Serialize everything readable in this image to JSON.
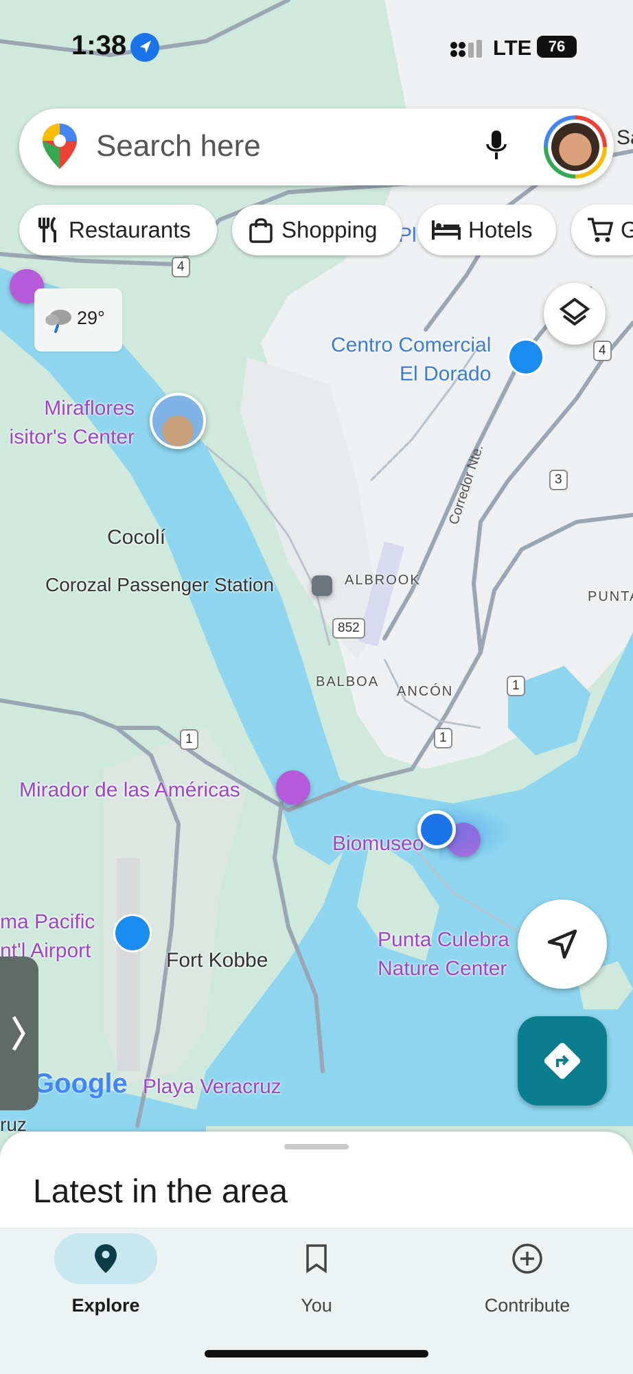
{
  "status_bar": {
    "time": "1:38",
    "network": "LTE",
    "battery": "76"
  },
  "search": {
    "placeholder": "Search here",
    "partial_label": "Sa"
  },
  "chips": [
    {
      "label": "Restaurants",
      "icon": "utensils-icon"
    },
    {
      "label": "Shopping",
      "icon": "shopping-bag-icon"
    },
    {
      "label": "Hotels",
      "icon": "bed-icon"
    },
    {
      "label": "G",
      "icon": "cart-icon"
    }
  ],
  "weather": {
    "temperature": "29°",
    "icon": "rain-cloud-icon"
  },
  "map": {
    "poi": {
      "centro_1": "Centro Comercial",
      "centro_2": "El Dorado",
      "miraflores_1": "Miraflores",
      "miraflores_2": "isitor's Center",
      "corozal": "Corozal Passenger Station",
      "mirador": "Mirador de las Américas",
      "biomuseo": "Biomuseo",
      "punta_1": "Punta Culebra",
      "punta_2": "Nature Center",
      "airport_1": "ma Pacific",
      "airport_2": "nt'l Airport",
      "playa": "Playa Veracruz"
    },
    "places": {
      "cocoli": "Cocolí",
      "fort_kobbe": "Fort Kobbe",
      "ruz": "ruz"
    },
    "districts": {
      "albrook": "ALBROOK",
      "balboa": "BALBOA",
      "ancon": "ANCÓN",
      "punta": "PUNTA"
    },
    "roads": {
      "r4a": "4",
      "r4b": "4",
      "r3": "3",
      "r852": "852",
      "r1a": "1",
      "r1b": "1",
      "r1c": "1",
      "corredor": "Corredor Nte.",
      "pl": "Pl"
    },
    "google_logo": "Google"
  },
  "colors": {
    "accent": "#0a7d8e",
    "location_dot": "#1a73e8",
    "poi": "#9d45c9",
    "water": "#8ed6ef",
    "park": "#cfe9dc"
  },
  "bottom_sheet": {
    "title": "Latest in the area"
  },
  "nav": {
    "explore": "Explore",
    "you": "You",
    "contribute": "Contribute"
  }
}
